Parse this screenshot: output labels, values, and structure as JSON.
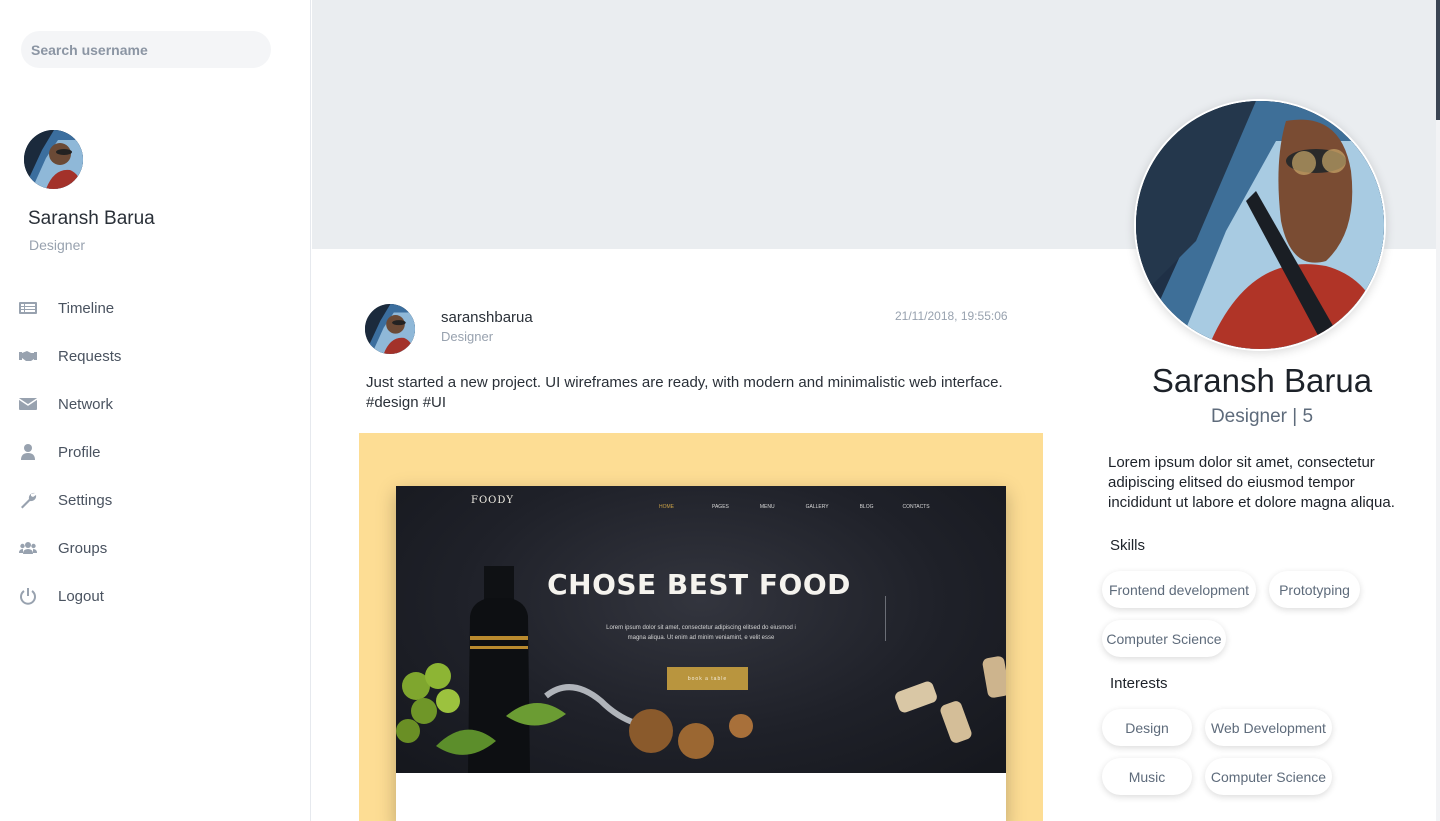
{
  "search": {
    "placeholder": "Search username"
  },
  "sidebar": {
    "profile": {
      "name": "Saransh Barua",
      "role": "Designer"
    },
    "nav": [
      {
        "label": "Timeline",
        "icon": "timeline-icon"
      },
      {
        "label": "Requests",
        "icon": "handshake-icon"
      },
      {
        "label": "Network",
        "icon": "envelope-icon"
      },
      {
        "label": "Profile",
        "icon": "user-icon"
      },
      {
        "label": "Settings",
        "icon": "wrench-icon"
      },
      {
        "label": "Groups",
        "icon": "users-icon"
      },
      {
        "label": "Logout",
        "icon": "power-icon"
      }
    ]
  },
  "post": {
    "username": "saranshbarua",
    "role": "Designer",
    "timestamp": "21/11/2018, 19:55:06",
    "text": "Just started a new project. UI wireframes are ready, with modern and minimalistic web interface.",
    "tags": "#design #UI",
    "image": {
      "logo": "FOODY",
      "nav": [
        "HOME",
        "PAGES",
        "MENU",
        "GALLERY",
        "BLOG",
        "CONTACTS"
      ],
      "headline": "CHOSE BEST FOOD",
      "subtext_line1": "Lorem ipsum dolor sit amet, consectetur adipiscing elitsed do eiusmod i",
      "subtext_line2": "magna aliqua. Ut enim ad minim veniamint, e velit esse",
      "button": "book a table"
    }
  },
  "profile_card": {
    "name": "Saransh Barua",
    "role": "Designer | 5",
    "bio": "Lorem ipsum dolor sit amet, consectetur adipiscing elitsed do eiusmod tempor incididunt ut labore et dolore magna aliqua.",
    "skills_title": "Skills",
    "skills": [
      "Frontend development",
      "Prototyping",
      "Computer Science"
    ],
    "interests_title": "Interests",
    "interests": [
      "Design",
      "Web Development",
      "Music",
      "Computer Science"
    ]
  },
  "colors": {
    "accent_bg": "#eaedf0",
    "post_image_bg": "#fddd94",
    "icon_gray": "#98a2af",
    "button_gold": "#b9953e"
  }
}
